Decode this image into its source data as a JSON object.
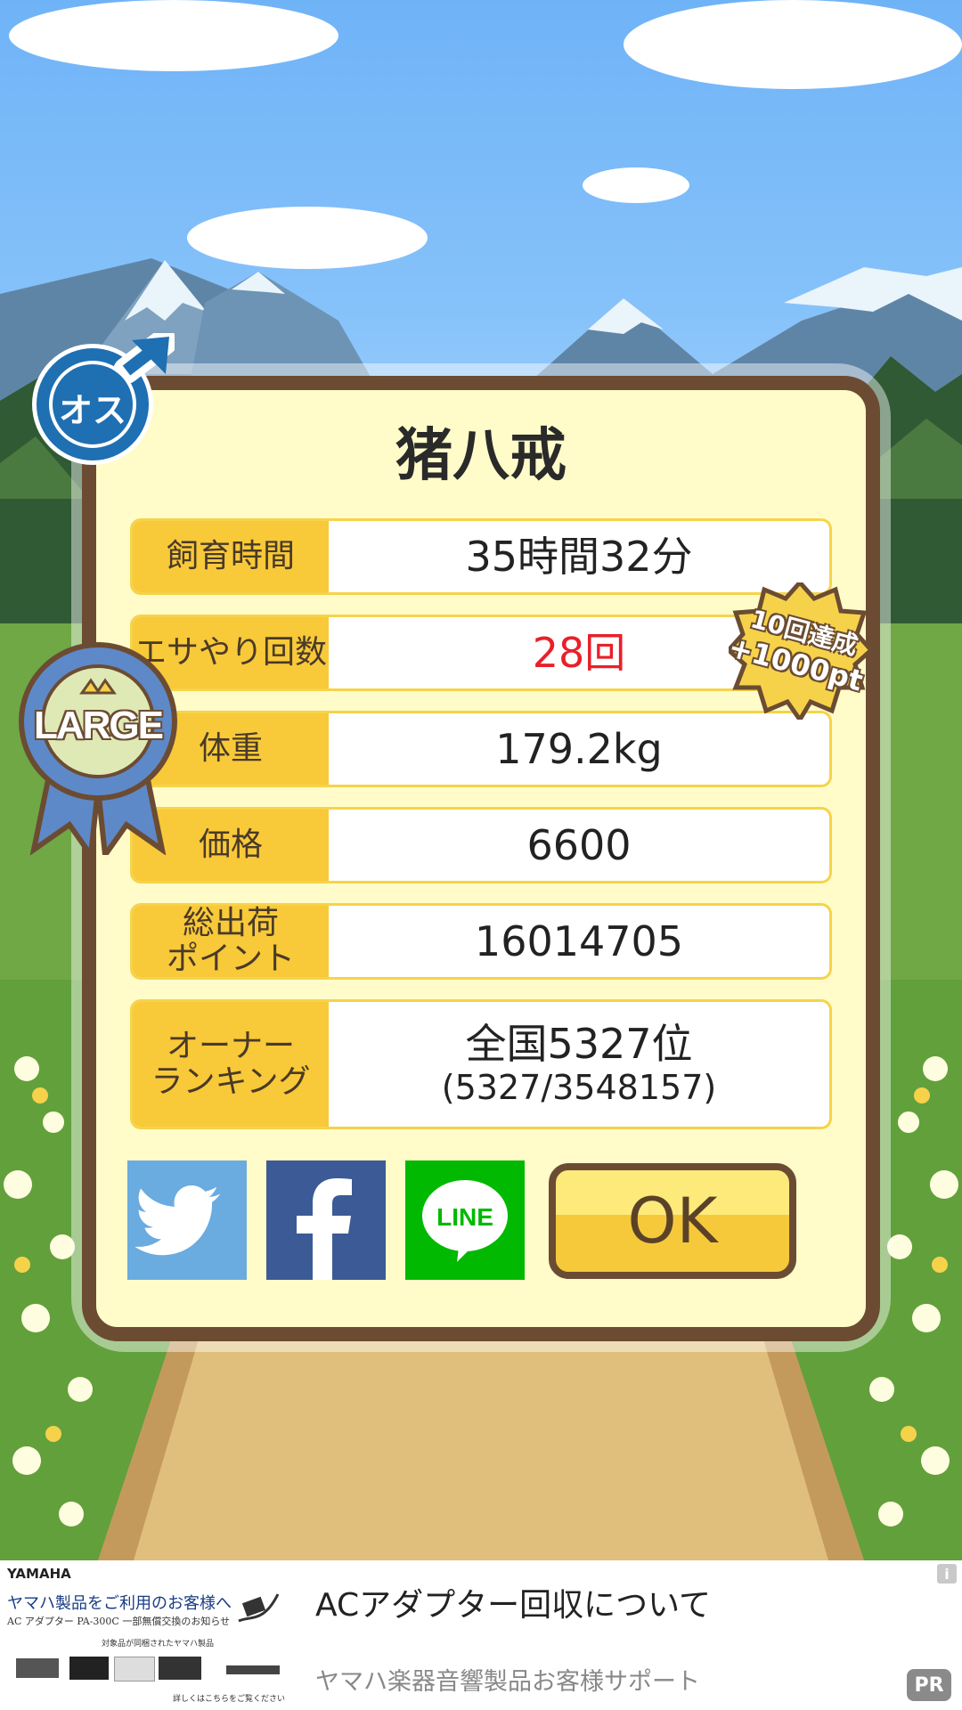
{
  "pet": {
    "name": "猪八戒",
    "gender_badge": "オス",
    "size_ribbon": "LARGE"
  },
  "stats": [
    {
      "label": "飼育時間",
      "value": "35時間32分"
    },
    {
      "label": "エサやり回数",
      "value": "28回",
      "highlight": "#e8202a"
    },
    {
      "label": "体重",
      "value": "179.2kg"
    },
    {
      "label": "価格",
      "value": "6600"
    },
    {
      "label": "総出荷\nポイント",
      "value": "16014705"
    },
    {
      "label": "オーナー\nランキング",
      "value": "全国5327位",
      "sub": "(5327/3548157)"
    }
  ],
  "achievement_badge": {
    "line1": "10回達成",
    "line2": "+1000pt"
  },
  "share": {
    "twitter_icon": "twitter-bird-icon",
    "facebook_icon": "facebook-f-icon",
    "line_label": "LINE"
  },
  "ok_label": "OK",
  "ad": {
    "brand": "YAMAHA",
    "thumb_headline": "ヤマハ製品をご利用のお客様へ",
    "thumb_sub": "AC アダプター PA-300C 一部無償交換のお知らせ",
    "thumb_caption": "対象品が同梱されたヤマハ製品",
    "thumb_more": "詳しくはこちらをご覧ください ≫",
    "title": "ACアダプター回収について",
    "sponsor": "ヤマハ楽器音響製品お客様サポート",
    "pr_label": "PR",
    "info_icon": "i"
  },
  "colors": {
    "panel_border": "#6b4c33",
    "panel_bg": "#fffcc9",
    "label_bg": "#f8c939",
    "twitter": "#6aabe0",
    "facebook": "#3b5a96",
    "line": "#00b900"
  }
}
